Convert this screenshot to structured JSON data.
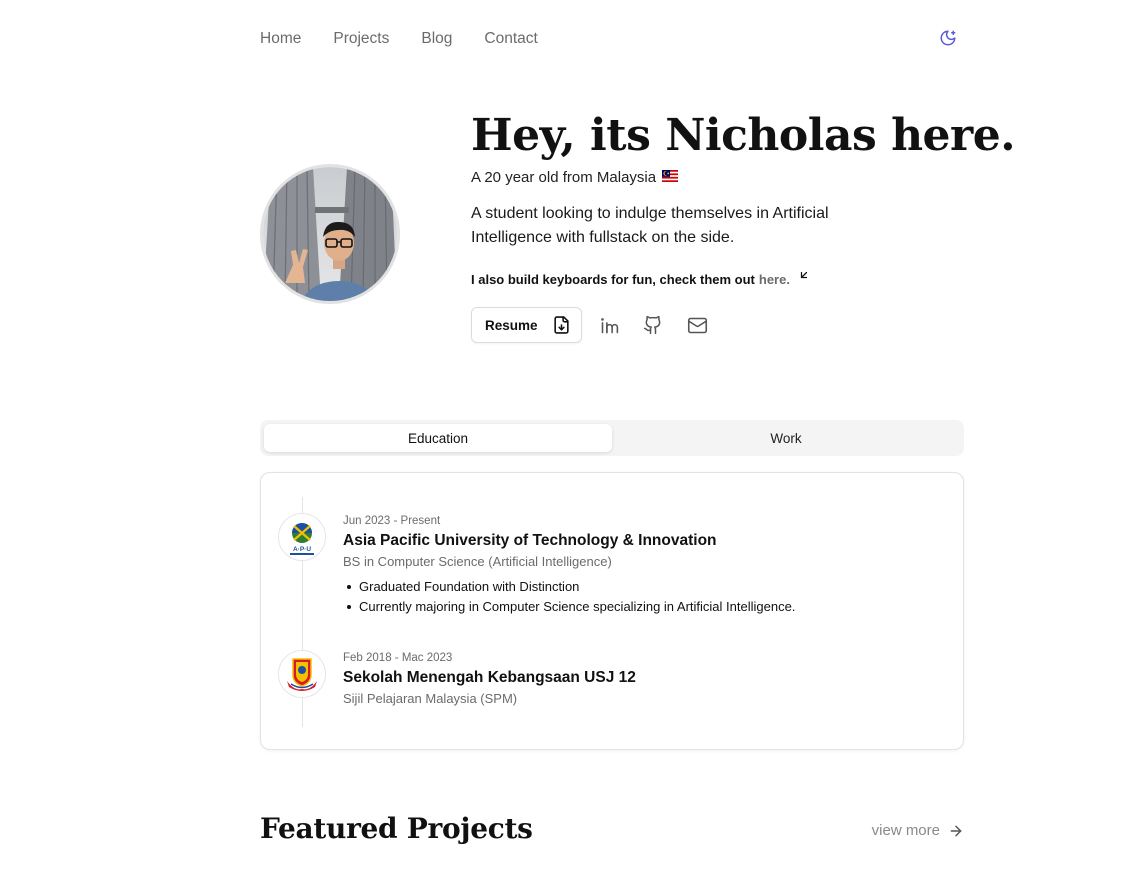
{
  "nav": {
    "links": [
      "Home",
      "Projects",
      "Blog",
      "Contact"
    ],
    "theme_icon": "moon-icon",
    "accent_color": "#5b5bd6"
  },
  "hero": {
    "title": "Hey, its Nicholas here.",
    "subtitle": "A 20 year old from Malaysia",
    "flag_icon": "malaysia-flag-icon",
    "description": "A student looking to indulge themselves in Artificial Intelligence with fullstack on the side.",
    "keyboards_text": "I also build keyboards for fun, check them out",
    "keyboards_link": "here.",
    "resume_label": "Resume",
    "social_icons": [
      "linkedin-icon",
      "github-icon",
      "mail-icon"
    ]
  },
  "tabs": {
    "items": [
      "Education",
      "Work"
    ],
    "active": "Education"
  },
  "education": [
    {
      "date": "Jun 2023 - Present",
      "name": "Asia Pacific University of Technology & Innovation",
      "degree": "BS in Computer Science (Artificial Intelligence)",
      "logo_text": "A·P·U",
      "bullets": [
        "Graduated Foundation with Distinction",
        "Currently majoring in Computer Science specializing in Artificial Intelligence."
      ]
    },
    {
      "date": "Feb 2018 - Mac 2023",
      "name": "Sekolah Menengah Kebangsaan USJ 12",
      "degree": "Sijil Pelajaran Malaysia (SPM)",
      "bullets": []
    }
  ],
  "featured": {
    "title": "Featured Projects",
    "view_more": "view more"
  }
}
